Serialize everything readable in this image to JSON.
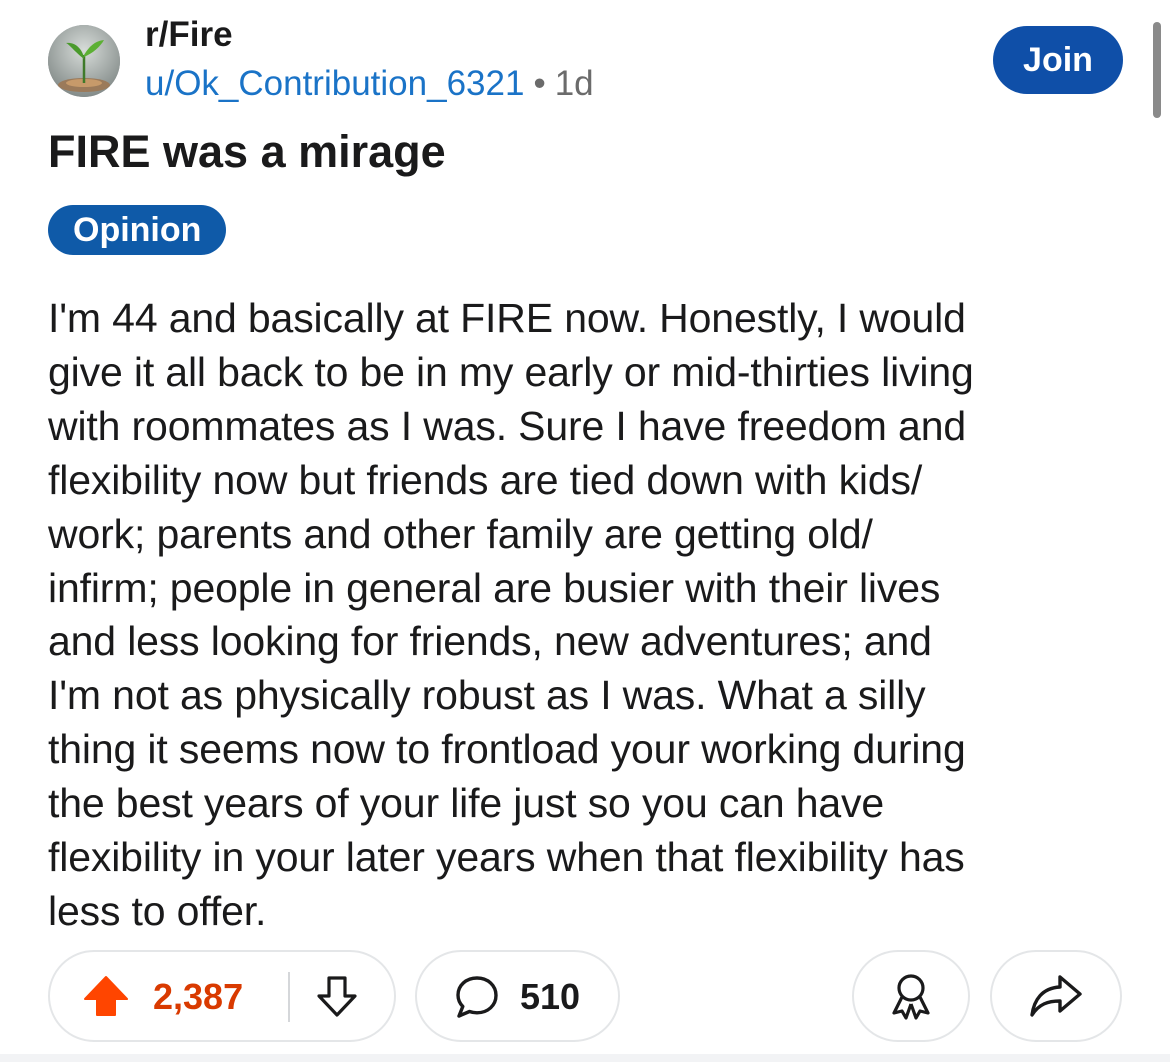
{
  "post": {
    "subreddit": "r/Fire",
    "author": "u/Ok_Contribution_6321",
    "separator": "•",
    "age": "1d",
    "join_label": "Join",
    "title": "FIRE was a mirage",
    "flair": "Opinion",
    "body": "I'm 44 and basically at FIRE now. Honestly, I would\ngive it all back to be in my early or mid-thirties living\nwith roommates as I was. Sure I have freedom and\nflexibility now but friends are tied down with kids/\nwork; parents and other family are getting old/\ninfirm; people in general are busier with their lives\nand less looking for friends, new adventures; and\nI'm not as physically robust as I was. What a silly\nthing it seems now to frontload your working during\nthe best years of your life just so you can have\nflexibility in your later years when that flexibility has\nless to offer."
  },
  "actions": {
    "upvotes": "2,387",
    "comments": "510",
    "upvote_icon": "upvote-arrow-icon",
    "downvote_icon": "downvote-arrow-icon",
    "comment_icon": "comment-bubble-icon",
    "award_icon": "award-icon",
    "share_icon": "share-arrow-icon"
  },
  "colors": {
    "join_button": "#0f4fa8",
    "flair": "#0f5aa8",
    "author_link": "#1a73c7",
    "upvoted": "#d93a00"
  }
}
